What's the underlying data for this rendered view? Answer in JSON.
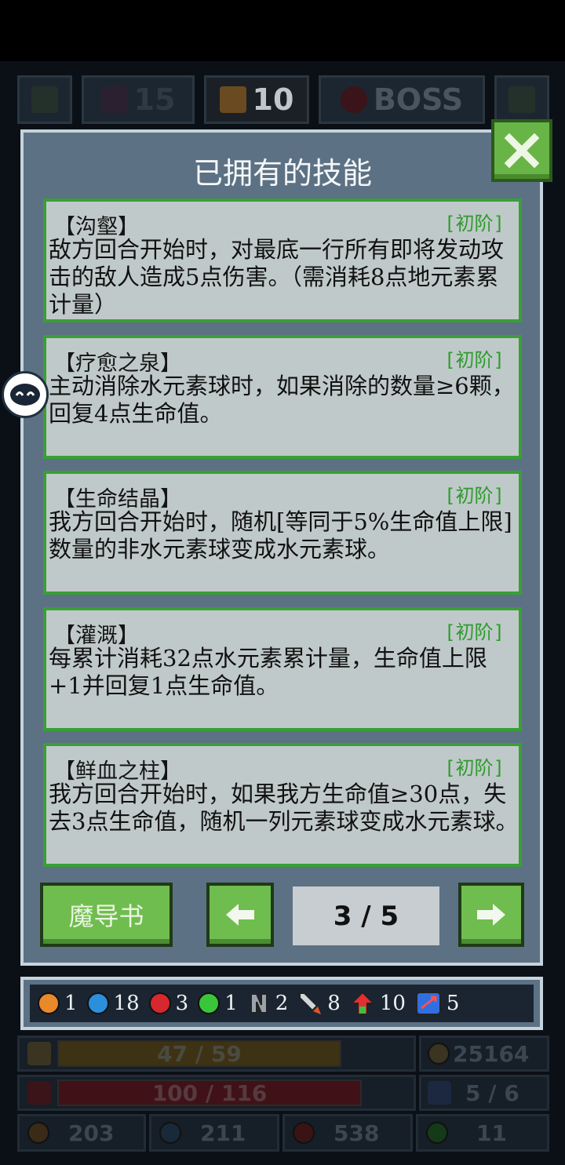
{
  "top_bar": {
    "shards_count": "15",
    "floor_count": "10",
    "boss_label": "BOSS"
  },
  "modal": {
    "title": "已拥有的技能",
    "skills": [
      {
        "name": "【沟壑】",
        "tier": "[初阶]",
        "description": "敌方回合开始时，对最底一行所有即将发动攻击的敌人造成5点伤害。（需消耗8点地元素累计量）"
      },
      {
        "name": "【疗愈之泉】",
        "tier": "[初阶]",
        "description": "主动消除水元素球时，如果消除的数量≥6颗，回复4点生命值。"
      },
      {
        "name": "【生命结晶】",
        "tier": "[初阶]",
        "description": "我方回合开始时，随机[等同于5%生命值上限]数量的非水元素球变成水元素球。"
      },
      {
        "name": "【灌溉】",
        "tier": "[初阶]",
        "description": "每累计消耗32点水元素累计量，生命值上限+1并回复1点生命值。"
      },
      {
        "name": "【鲜血之柱】",
        "tier": "[初阶]",
        "description": "我方回合开始时，如果我方生命值≥30点，失去3点生命值，随机一列元素球变成水元素球。"
      }
    ],
    "grimoire_label": "魔导书",
    "page_indicator": "3 / 5"
  },
  "resources": [
    {
      "icon": "orange-orb-icon",
      "color": "#e8892a",
      "value": "1"
    },
    {
      "icon": "blue-orb-icon",
      "color": "#2b8fdc",
      "value": "18"
    },
    {
      "icon": "red-orb-icon",
      "color": "#d8282f",
      "value": "3"
    },
    {
      "icon": "green-orb-icon",
      "color": "#39c639",
      "value": "1"
    },
    {
      "icon": "chain-icon",
      "color": "#9aa3aa",
      "value": "2"
    },
    {
      "icon": "sword-icon",
      "color": "#d0d6da",
      "value": "8"
    },
    {
      "icon": "level-up-icon",
      "color": "#e03030",
      "value": "10"
    },
    {
      "icon": "reroll-icon",
      "color": "#2f6fe0",
      "value": "5"
    }
  ],
  "stats": {
    "exp": "47 / 59",
    "gold": "25164",
    "hp": "100 / 116",
    "energy": "5 / 6",
    "earth": "203",
    "water": "211",
    "fire": "538",
    "wind": "11"
  }
}
